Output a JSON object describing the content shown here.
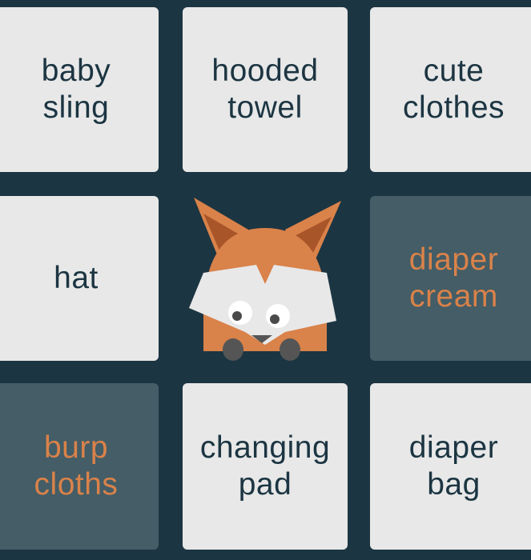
{
  "board": {
    "tiles": [
      {
        "label": "baby\nsling",
        "state": "open"
      },
      {
        "label": "hooded\ntowel",
        "state": "open"
      },
      {
        "label": "cute\nclothes",
        "state": "open"
      },
      {
        "label": "hat",
        "state": "open"
      },
      {
        "label": "",
        "state": "free"
      },
      {
        "label": "diaper\ncream",
        "state": "marked"
      },
      {
        "label": "burp\ncloths",
        "state": "marked"
      },
      {
        "label": "changing\npad",
        "state": "open"
      },
      {
        "label": "diaper\nbag",
        "state": "open"
      }
    ],
    "mascot": "fox-icon"
  },
  "colors": {
    "background": "#1c3542",
    "tile_open": "#e8e8e8",
    "tile_marked": "#445d66",
    "text_open": "#1c3542",
    "text_marked": "#d9824a",
    "fox_orange": "#d9824a"
  }
}
